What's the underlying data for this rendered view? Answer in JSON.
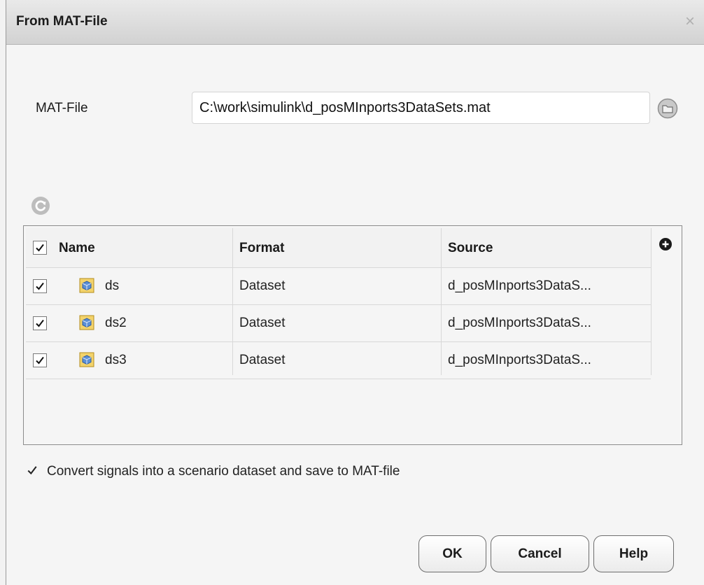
{
  "dialog": {
    "title": "From MAT-File",
    "close_glyph": "×"
  },
  "mat_file": {
    "label": "MAT-File",
    "value": "C:\\work\\simulink\\d_posMInports3DataSets.mat",
    "browse_icon": "folder-open-icon"
  },
  "refresh_icon": "refresh-icon",
  "table": {
    "header_checked": true,
    "columns": [
      "Name",
      "Format",
      "Source"
    ],
    "add_column_icon": "plus-circle-icon",
    "rows": [
      {
        "checked": true,
        "name": "ds",
        "format": "Dataset",
        "source": "d_posMInports3DataS..."
      },
      {
        "checked": true,
        "name": "ds2",
        "format": "Dataset",
        "source": "d_posMInports3DataS..."
      },
      {
        "checked": true,
        "name": "ds3",
        "format": "Dataset",
        "source": "d_posMInports3DataS..."
      }
    ]
  },
  "convert": {
    "checked": true,
    "label": "Convert signals into a scenario dataset and save to MAT-file"
  },
  "buttons": {
    "ok": "OK",
    "cancel": "Cancel",
    "help": "Help"
  },
  "colors": {
    "titlebar": "#d9d9d9",
    "background": "#f5f5f5",
    "dataset_icon_fill": "#f3d36b",
    "dataset_icon_cube": "#5b8fd6"
  }
}
